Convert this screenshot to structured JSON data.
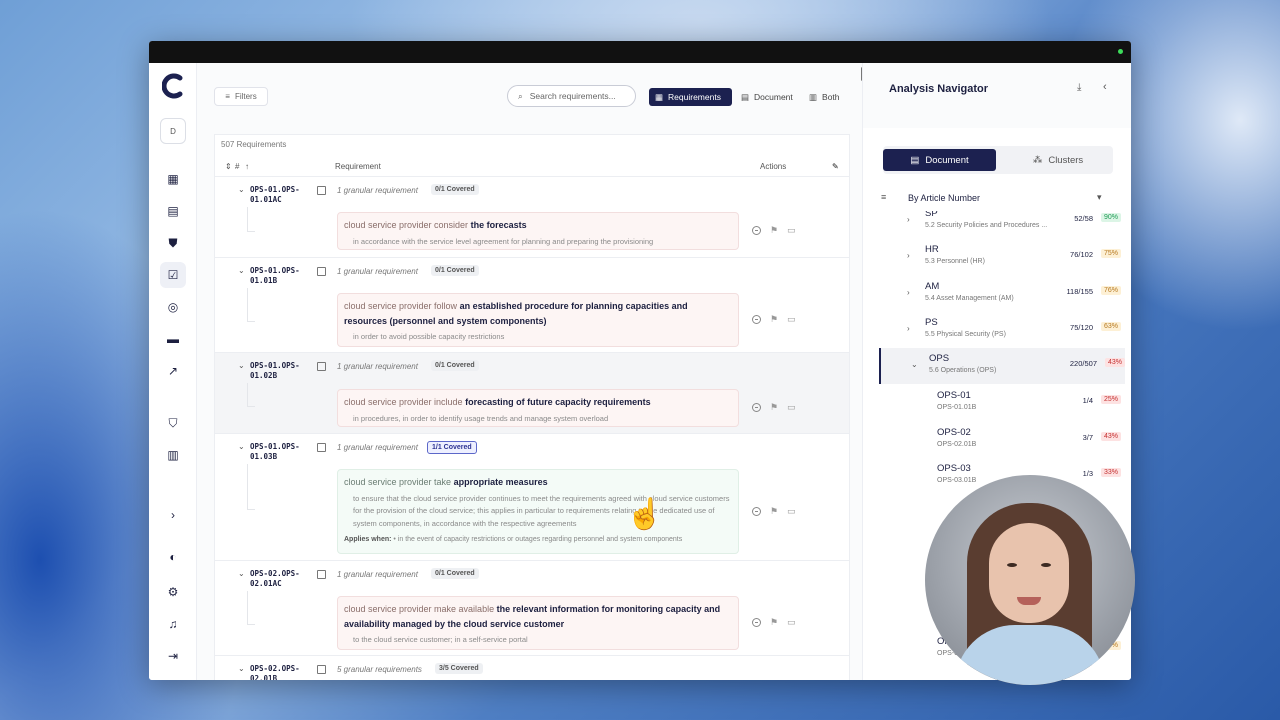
{
  "toolbar": {
    "filters_label": "Filters",
    "search_placeholder": "Search requirements...",
    "views": [
      "Requirements",
      "Document",
      "Both"
    ],
    "active_view": "Requirements"
  },
  "table": {
    "count_label": "507 Requirements",
    "col_number": "#",
    "col_requirement": "Requirement",
    "col_actions": "Actions",
    "rows": [
      {
        "id": "OPS-01.OPS-01.01AC",
        "granular": "1 granular requirement",
        "coverage": "0/1 Covered",
        "subject": "cloud service provider consider",
        "object": "the forecasts",
        "detail": "in accordance with the service level agreement for planning and preparing the provisioning"
      },
      {
        "id": "OPS-01.OPS-01.01B",
        "granular": "1 granular requirement",
        "coverage": "0/1 Covered",
        "subject": "cloud service provider follow",
        "object": "an established procedure for planning capacities and resources (personnel and system components)",
        "detail": "in order to avoid possible capacity restrictions"
      },
      {
        "id": "OPS-01.OPS-01.02B",
        "granular": "1 granular requirement",
        "coverage": "0/1 Covered",
        "subject": "cloud service provider include",
        "object": "forecasting of future capacity requirements",
        "detail": "in procedures, in order to identify usage trends and manage system overload"
      },
      {
        "id": "OPS-01.OPS-01.03B",
        "granular": "1 granular requirement",
        "coverage": "1/1 Covered",
        "subject": "cloud service provider take",
        "object": "appropriate measures",
        "detail": "to ensure that the cloud service provider continues to meet the requirements agreed with cloud service customers for the provision of the cloud service; this applies in particular to requirements relating to the dedicated use of system components, in accordance with the respective agreements",
        "applies_label": "Applies when:",
        "applies_text": "• in the event of capacity restrictions or outages regarding personnel and system components"
      },
      {
        "id": "OPS-02.OPS-02.01AC",
        "granular": "1 granular requirement",
        "coverage": "0/1 Covered",
        "subject": "cloud service provider make available",
        "object": "the relevant information for monitoring capacity and availability managed by the cloud service customer",
        "detail": "to the cloud service customer; in a self-service portal"
      },
      {
        "id": "OPS-02.OPS-02.01B",
        "granular": "5 granular requirements",
        "coverage": "3/5 Covered"
      }
    ]
  },
  "navigator": {
    "title": "Analysis Navigator",
    "tabs": [
      "Document",
      "Clusters"
    ],
    "active_tab": "Document",
    "sort_label": "By Article Number",
    "items": [
      {
        "code": "SP",
        "sub": "5.2 Security Policies and Procedures ...",
        "ratio": "52/58",
        "pct": "90%",
        "pct_color": "#1f9d55",
        "pct_bg": "#dcf5e6"
      },
      {
        "code": "HR",
        "sub": "5.3 Personnel (HR)",
        "ratio": "76/102",
        "pct": "75%",
        "pct_color": "#b7791f",
        "pct_bg": "#fdf0d5"
      },
      {
        "code": "AM",
        "sub": "5.4 Asset Management (AM)",
        "ratio": "118/155",
        "pct": "76%",
        "pct_color": "#b7791f",
        "pct_bg": "#fdf0d5"
      },
      {
        "code": "PS",
        "sub": "5.5 Physical Security (PS)",
        "ratio": "75/120",
        "pct": "63%",
        "pct_color": "#b7791f",
        "pct_bg": "#fdf0d5"
      },
      {
        "code": "OPS",
        "sub": "5.6 Operations (OPS)",
        "ratio": "220/507",
        "pct": "43%",
        "pct_color": "#c53030",
        "pct_bg": "#fde2e2"
      }
    ],
    "children": [
      {
        "code": "OPS-01",
        "sub": "OPS-01.01B",
        "ratio": "1/4",
        "pct": "25%"
      },
      {
        "code": "OPS-02",
        "sub": "OPS-02.01B",
        "ratio": "3/7",
        "pct": "43%"
      },
      {
        "code": "OPS-03",
        "sub": "OPS-03.01B",
        "ratio": "1/3",
        "pct": "33%"
      }
    ],
    "bottom_child": {
      "code": "OPS-0",
      "sub": "OPS-08.01B",
      "pct": "64%"
    }
  },
  "colors": {
    "brand": "#1c2150",
    "danger": "#c53030",
    "covered_accent": "#5c67c9"
  },
  "rail_icons": [
    "dashboard-icon",
    "document-icon",
    "shield-icon",
    "checklist-icon",
    "target-icon",
    "chat-icon",
    "trend-icon",
    "security-settings-icon",
    "building-icon",
    "expand-icon",
    "dark-mode-icon",
    "settings-icon",
    "bell-icon",
    "logout-icon"
  ],
  "avatar_initial": "D"
}
